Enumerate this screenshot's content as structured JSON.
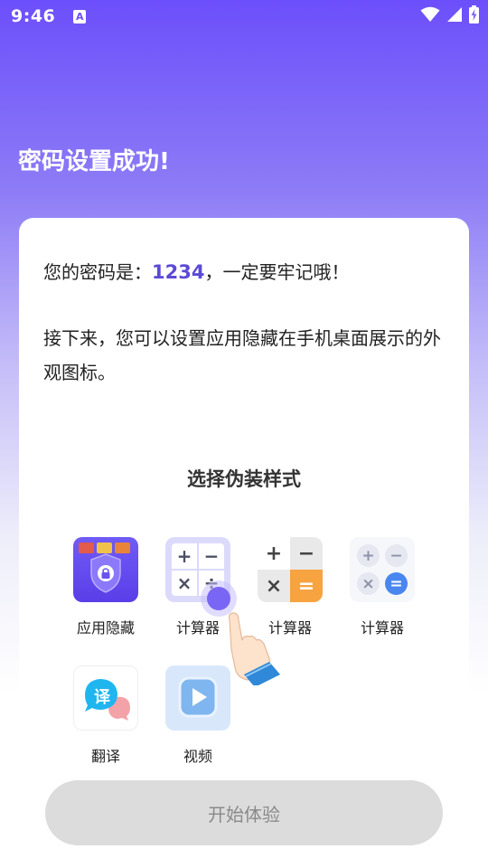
{
  "status_bar": {
    "time": "9:46",
    "notification_glyph": "A",
    "icons": [
      "wifi-icon",
      "signal-icon",
      "battery-charging-icon"
    ]
  },
  "header": {
    "title": "密码设置成功!"
  },
  "card": {
    "password_prefix": "您的密码是：",
    "password_value": "1234",
    "password_suffix": "，一定要牢记哦！",
    "description": "接下来，您可以设置应用隐藏在手机桌面展示的外观图标。",
    "choose_title": "选择伪装样式",
    "styles": [
      {
        "label": "应用隐藏",
        "icon": "app-hide-icon"
      },
      {
        "label": "计算器",
        "icon": "calculator-purple-icon"
      },
      {
        "label": "计算器",
        "icon": "calculator-orange-icon"
      },
      {
        "label": "计算器",
        "icon": "calculator-soft-icon"
      },
      {
        "label": "翻译",
        "icon": "translate-icon"
      },
      {
        "label": "视频",
        "icon": "video-play-icon"
      }
    ],
    "calc_symbols": {
      "plus": "+",
      "minus": "−",
      "times": "×",
      "divide": "÷",
      "equals": "="
    },
    "translate_glyph": "译"
  },
  "cta": {
    "label": "开始体验",
    "enabled": false
  },
  "colors": {
    "accent": "#6c4ffb",
    "password_highlight": "#5b4ad6",
    "orange": "#f7a340",
    "cta_bg": "#dcdcdc"
  }
}
